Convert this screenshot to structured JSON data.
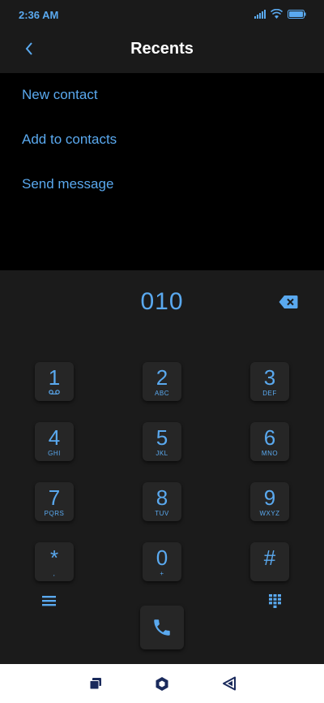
{
  "status": {
    "time": "2:36 AM"
  },
  "header": {
    "title": "Recents"
  },
  "menu": {
    "items": [
      {
        "label": "New contact"
      },
      {
        "label": "Add to contacts"
      },
      {
        "label": "Send message"
      }
    ]
  },
  "dialer": {
    "number": "010",
    "keys": [
      {
        "digit": "1",
        "letters": ""
      },
      {
        "digit": "2",
        "letters": "ABC"
      },
      {
        "digit": "3",
        "letters": "DEF"
      },
      {
        "digit": "4",
        "letters": "GHI"
      },
      {
        "digit": "5",
        "letters": "JKL"
      },
      {
        "digit": "6",
        "letters": "MNO"
      },
      {
        "digit": "7",
        "letters": "PQRS"
      },
      {
        "digit": "8",
        "letters": "TUV"
      },
      {
        "digit": "9",
        "letters": "WXYZ"
      },
      {
        "digit": "*",
        "letters": ","
      },
      {
        "digit": "0",
        "letters": "+"
      },
      {
        "digit": "#",
        "letters": ""
      }
    ]
  },
  "colors": {
    "accent": "#5aa9ef",
    "keypad_bg": "#1b1b1b",
    "key_bg": "#262626"
  }
}
